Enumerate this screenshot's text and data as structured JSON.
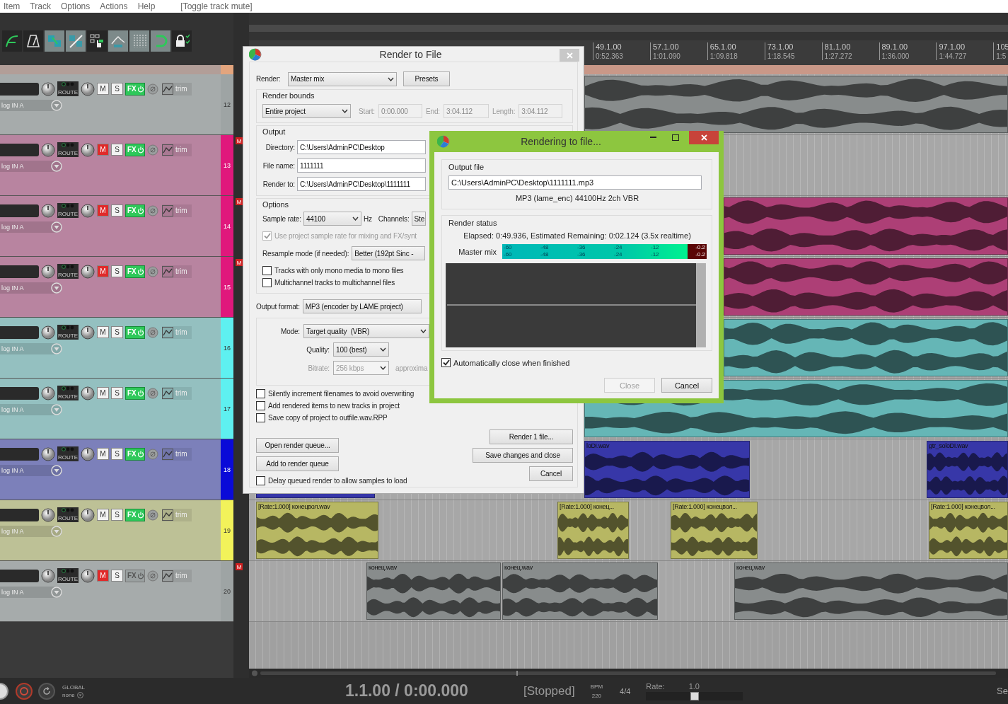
{
  "menu": [
    "Item",
    "Track",
    "Options",
    "Actions",
    "Help"
  ],
  "menu_status": "[Toggle track mute]",
  "toolbar": [
    {
      "kind": "curve",
      "on": false
    },
    {
      "kind": "metronome",
      "on": false
    },
    {
      "kind": "group",
      "on": true
    },
    {
      "kind": "link",
      "on": true
    },
    {
      "kind": "select",
      "on": false
    },
    {
      "kind": "envelope",
      "on": true
    },
    {
      "kind": "grid",
      "on": true
    },
    {
      "kind": "snap",
      "on": true
    },
    {
      "kind": "lock",
      "on": false
    }
  ],
  "ruler": [
    {
      "bar": "49.1.00",
      "time": "0:52.363"
    },
    {
      "bar": "57.1.00",
      "time": "1:01.090"
    },
    {
      "bar": "65.1.00",
      "time": "1:09.818"
    },
    {
      "bar": "73.1.00",
      "time": "1:18.545"
    },
    {
      "bar": "81.1.00",
      "time": "1:27.272"
    },
    {
      "bar": "89.1.00",
      "time": "1:36.000"
    },
    {
      "bar": "97.1.00",
      "time": "1:44.727"
    },
    {
      "bar": "105",
      "time": "1:5"
    }
  ],
  "tracks": [
    {
      "number": "12",
      "color": "#9ea4a4",
      "route": "ROUTE",
      "mute": "M",
      "solo": "S",
      "fx": "FX",
      "trim": "trim",
      "input": "log IN A",
      "muted": false,
      "fx_on": true,
      "items": [
        {
          "kind": "audio"
        }
      ]
    },
    {
      "number": "13",
      "color": "#e0187c",
      "route": "ROUTE",
      "mute": "M",
      "solo": "S",
      "fx": "FX",
      "trim": "trim",
      "input": "log IN A",
      "muted": true,
      "badge": "M",
      "fx_on": true
    },
    {
      "number": "14",
      "color": "#e0187c",
      "route": "ROUTE",
      "mute": "M",
      "solo": "S",
      "fx": "FX",
      "trim": "trim",
      "input": "log IN A",
      "muted": true,
      "badge": "M",
      "fx_on": true,
      "items": [
        {
          "kind": "audio"
        }
      ]
    },
    {
      "number": "15",
      "color": "#e0187c",
      "route": "ROUTE",
      "mute": "M",
      "solo": "S",
      "fx": "FX",
      "trim": "trim",
      "input": "log IN A",
      "muted": true,
      "badge": "M",
      "fx_on": true,
      "items": [
        {
          "kind": "audio"
        }
      ]
    },
    {
      "number": "16",
      "color": "#5ef0f0",
      "route": "ROUTE",
      "mute": "M",
      "solo": "S",
      "fx": "FX",
      "trim": "trim",
      "input": "log IN A",
      "muted": false,
      "fx_on": true,
      "items": [
        {
          "kind": "audio"
        }
      ]
    },
    {
      "number": "17",
      "color": "#5ef0f0",
      "route": "ROUTE",
      "mute": "M",
      "solo": "S",
      "fx": "FX",
      "trim": "trim",
      "input": "log IN A",
      "muted": false,
      "fx_on": true,
      "items": [
        {
          "kind": "audio"
        }
      ]
    },
    {
      "number": "18",
      "color": "#0a0ad8",
      "route": "ROUTE",
      "mute": "M",
      "solo": "S",
      "fx": "FX",
      "trim": "trim",
      "input": "log IN A",
      "muted": false,
      "fx_on": true,
      "items": [
        {
          "kind": "audio"
        },
        {
          "kind": "audio",
          "name": "loDI.wav"
        },
        {
          "kind": "audio",
          "name": "gtr_soloDI.wav"
        }
      ]
    },
    {
      "number": "19",
      "color": "#f2f25a",
      "route": "ROUTE",
      "mute": "M",
      "solo": "S",
      "fx": "FX",
      "trim": "trim",
      "input": "log IN A",
      "muted": false,
      "fx_on": true,
      "items": [
        {
          "kind": "audio",
          "name": "[Rate:1.000] конецвол.wav"
        },
        {
          "kind": "audio",
          "name": "[Rate:1.000] конец..."
        },
        {
          "kind": "audio",
          "name": "[Rate:1.000] конецвол..."
        },
        {
          "kind": "audio",
          "name": "[Rate:1.000] конецвол..."
        }
      ]
    },
    {
      "number": "20",
      "color": "#9ea4a4",
      "route": "ROUTE",
      "mute": "M",
      "solo": "S",
      "fx": "FX",
      "trim": "trim",
      "input": "log IN A",
      "muted": true,
      "badge": "M",
      "fx_on": false,
      "items": [
        {
          "kind": "audio",
          "name": "конец.wav"
        },
        {
          "kind": "audio",
          "name": "конец.wav"
        },
        {
          "kind": "audio",
          "name": "конец.wav"
        }
      ]
    }
  ],
  "render_dialog": {
    "title": "Render to File",
    "render_label": "Render:",
    "render_source": "Master mix",
    "presets": "Presets",
    "bounds": {
      "legend": "Render bounds",
      "mode": "Entire project",
      "start_label": "Start:",
      "start": "0:00.000",
      "end_label": "End:",
      "end": "3:04.112",
      "length_label": "Length:",
      "length": "3:04.112",
      "disabled": true
    },
    "output": {
      "legend": "Output",
      "fields": [
        {
          "label": "Directory:",
          "value": "C:\\Users\\AdminPC\\Desktop"
        },
        {
          "label": "File name:",
          "value": "1111111"
        },
        {
          "label": "Render to:",
          "value": "C:\\Users\\AdminPC\\Desktop\\1111111"
        }
      ]
    },
    "options": {
      "legend": "Options",
      "sample_rate_label": "Sample rate:",
      "sample_rate": "44100",
      "hz": "Hz",
      "channels_label": "Channels:",
      "channels": "Ste",
      "use_project_rate": {
        "label": "Use project sample rate for mixing and FX/synt",
        "checked": true,
        "disabled": true
      },
      "resample_label": "Resample mode (if needed):",
      "resample": "Better (192pt Sinc -",
      "checkboxes": [
        {
          "label": "Tracks with only mono media to mono files",
          "checked": false
        },
        {
          "label": "Multichannel tracks to multichannel files",
          "checked": false
        }
      ]
    },
    "format_label": "Output format:",
    "format": "MP3 (encoder by LAME project)",
    "encoder": {
      "mode_label": "Mode:",
      "mode": "Target quality  (VBR)",
      "quality_label": "Quality:",
      "quality": "100 (best)",
      "bitrate_label": "Bitrate:",
      "bitrate": "256 kbps",
      "bitrate_disabled": true,
      "note": "approxima"
    },
    "checkboxes": [
      {
        "label": "Silently increment filenames to avoid overwriting",
        "checked": false
      },
      {
        "label": "Add rendered items to new tracks in project",
        "checked": false
      },
      {
        "label": "Save copy of project to outfile.wav.RPP",
        "checked": false
      }
    ],
    "queue_buttons": [
      "Open render queue...",
      "Add to render queue"
    ],
    "delay": {
      "label": "Delay queued render to allow samples to load",
      "checked": false
    },
    "action_buttons": [
      "Render 1 file...",
      "Save changes and close",
      "Cancel"
    ]
  },
  "progress_dialog": {
    "title": "Rendering to file...",
    "output_legend": "Output file",
    "output_path": "C:\\Users\\AdminPC\\Desktop\\1111111.mp3",
    "format": "MP3 (lame_enc) 44100Hz 2ch VBR",
    "status_legend": "Render status",
    "status": "Elapsed: 0:49.936, Estimated Remaining: 0:02.124 (3.5x realtime)",
    "meter_label": "Master mix",
    "meter_rows": [
      {
        "ticks": [
          "-60",
          "-48",
          "-36",
          "-24",
          "-12"
        ],
        "peak": "-0.2"
      },
      {
        "ticks": [
          "-60",
          "-48",
          "-36",
          "-24",
          "-12"
        ],
        "peak": "-0.2"
      }
    ],
    "auto_close": {
      "label": "Automatically close when finished",
      "checked": true
    },
    "buttons": [
      {
        "label": "Close",
        "disabled": true
      },
      {
        "label": "Cancel",
        "disabled": false
      }
    ]
  },
  "transport": {
    "global": "GLOBAL",
    "automation": "none",
    "position": "1.1.00 / 0:00.000",
    "state": "[Stopped]",
    "bpm_label": "BPM",
    "bpm": "220",
    "signature": "4/4",
    "rate_label": "Rate:",
    "rate": "1.0",
    "rate_slider": {
      "level": 0.5
    },
    "cut_label": "Se"
  }
}
